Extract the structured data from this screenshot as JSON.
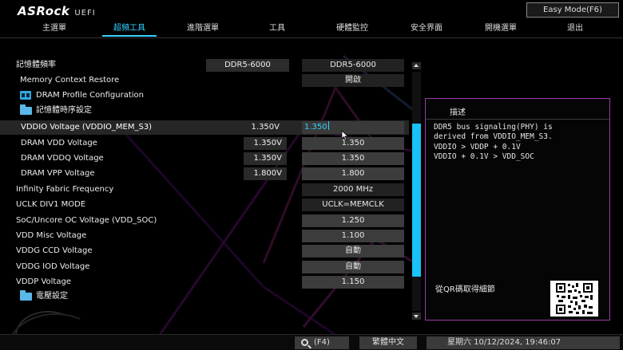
{
  "brand": {
    "logo": "ASRock",
    "suffix": "UEFI"
  },
  "easy_mode_button": "Easy Mode(F6)",
  "tabs": [
    {
      "label": "主選單",
      "active": false
    },
    {
      "label": "超頻工具",
      "active": true
    },
    {
      "label": "進階選單",
      "active": false
    },
    {
      "label": "工具",
      "active": false
    },
    {
      "label": "硬體監控",
      "active": false
    },
    {
      "label": "安全界面",
      "active": false
    },
    {
      "label": "開機選單",
      "active": false
    },
    {
      "label": "退出",
      "active": false
    }
  ],
  "settings": {
    "mem_freq": {
      "label": "記憶體頻率",
      "current": "DDR5-6000",
      "value": "DDR5-6000"
    },
    "mem_context": {
      "label": "Memory Context Restore",
      "value": "開啟"
    },
    "dram_profile": {
      "label": "DRAM Profile Configuration"
    },
    "timing": {
      "label": "記憶體時序設定"
    },
    "vddio": {
      "label": "VDDIO Voltage (VDDIO_MEM_S3)",
      "current": "1.350V",
      "value": "1.350"
    },
    "dram_vdd": {
      "label": "DRAM VDD Voltage",
      "current": "1.350V",
      "value": "1.350"
    },
    "dram_vddq": {
      "label": "DRAM VDDQ Voltage",
      "current": "1.350V",
      "value": "1.350"
    },
    "dram_vpp": {
      "label": "DRAM VPP Voltage",
      "current": "1.800V",
      "value": "1.800"
    },
    "fclk": {
      "label": "Infinity Fabric Frequency",
      "value": "2000 MHz"
    },
    "uclk": {
      "label": "UCLK DIV1 MODE",
      "value": "UCLK=MEMCLK"
    },
    "soc": {
      "label": "SoC/Uncore OC Voltage (VDD_SOC)",
      "value": "1.250"
    },
    "vdd_misc": {
      "label": "VDD Misc Voltage",
      "value": "1.100"
    },
    "vddg_ccd": {
      "label": "VDDG CCD Voltage",
      "value": "自動"
    },
    "vddg_iod": {
      "label": "VDDG IOD Voltage",
      "value": "自動"
    },
    "vddp": {
      "label": "VDDP Voltage",
      "value": "1.150"
    },
    "power": {
      "label": "電壓設定"
    }
  },
  "description": {
    "title": "描述",
    "text": "DDR5 bus signaling(PHY) is\nderived from VDDIO_MEM_S3.\nVDDIO > VDDP + 0.1V\nVDDIO + 0.1V > VDD_SOC",
    "qr_label": "從QR碼取得細節"
  },
  "scrollbar": {
    "position": 0.22,
    "visible_fraction": 0.64
  },
  "footer": {
    "search": "(F4)",
    "language": "繁體中文",
    "datetime": "星期六 10/12/2024, 19:46:07"
  },
  "colors": {
    "accent": "#33d1ff",
    "panel_border": "#9a3aa8",
    "scroll_thumb": "#19c3f5"
  }
}
